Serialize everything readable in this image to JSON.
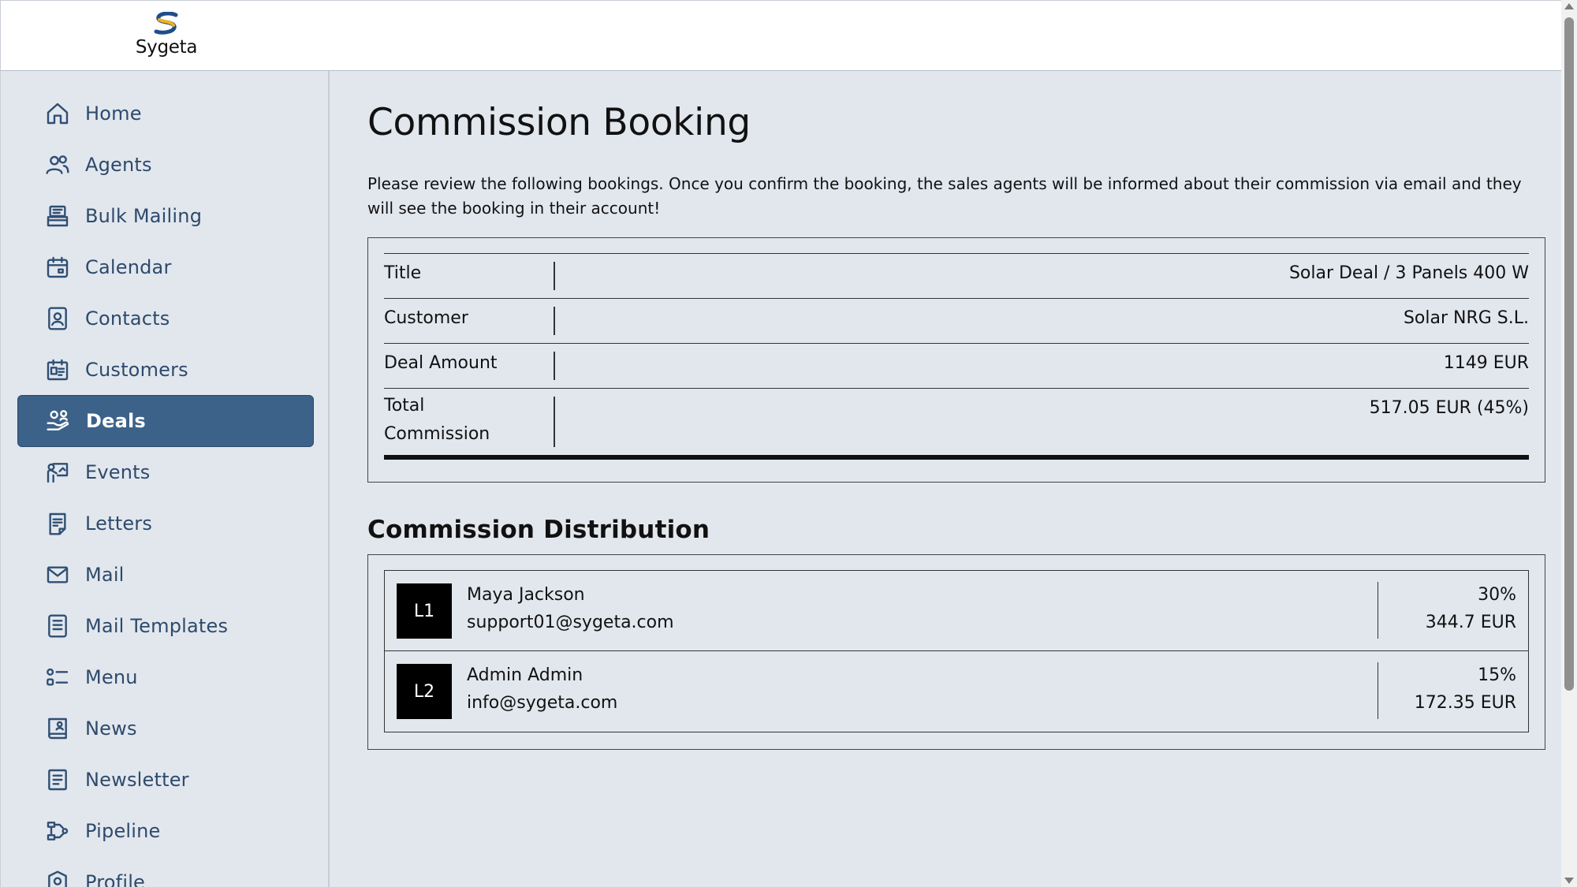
{
  "brand": {
    "name": "Sygeta"
  },
  "sidebar": {
    "items": [
      {
        "label": "Home",
        "icon": "home-icon"
      },
      {
        "label": "Agents",
        "icon": "users-icon"
      },
      {
        "label": "Bulk Mailing",
        "icon": "inbox-stack-icon"
      },
      {
        "label": "Calendar",
        "icon": "calendar-icon"
      },
      {
        "label": "Contacts",
        "icon": "contact-card-icon"
      },
      {
        "label": "Customers",
        "icon": "customers-calendar-icon"
      },
      {
        "label": "Deals",
        "icon": "hand-coins-icon",
        "active": true
      },
      {
        "label": "Events",
        "icon": "presentation-icon"
      },
      {
        "label": "Letters",
        "icon": "document-icon"
      },
      {
        "label": "Mail",
        "icon": "envelope-icon"
      },
      {
        "label": "Mail Templates",
        "icon": "template-list-icon"
      },
      {
        "label": "Menu",
        "icon": "menu-list-icon"
      },
      {
        "label": "News",
        "icon": "news-icon"
      },
      {
        "label": "Newsletter",
        "icon": "newsletter-icon"
      },
      {
        "label": "Pipeline",
        "icon": "pipeline-icon"
      },
      {
        "label": "Profile",
        "icon": "profile-icon"
      }
    ]
  },
  "main": {
    "title": "Commission Booking",
    "intro": "Please review the following bookings. Once you confirm the booking, the sales agents will be informed about their commission via email and they will see the booking in their account!",
    "details": [
      {
        "key": "Title",
        "value": "Solar Deal / 3 Panels 400 W"
      },
      {
        "key": "Customer",
        "value": "Solar NRG S.L."
      },
      {
        "key": "Deal Amount",
        "value": "1149 EUR"
      },
      {
        "key": "Total Commission",
        "value": "517.05 EUR (45%)"
      }
    ],
    "distribution_title": "Commission Distribution",
    "distribution": [
      {
        "level": "L1",
        "name": "Maya Jackson",
        "email": "support01@sygeta.com",
        "percent": "30%",
        "amount": "344.7 EUR"
      },
      {
        "level": "L2",
        "name": "Admin Admin",
        "email": "info@sygeta.com",
        "percent": "15%",
        "amount": "172.35 EUR"
      }
    ]
  },
  "colors": {
    "sidebar_active_bg": "#3d6289",
    "nav_text": "#2e4a6b",
    "background": "#e2e7ee"
  }
}
